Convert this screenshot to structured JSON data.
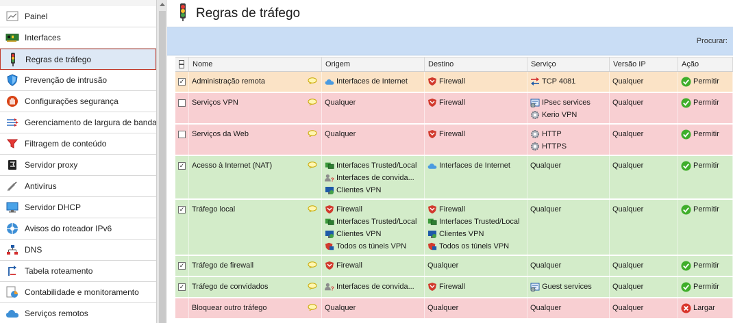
{
  "sidebar": {
    "items": [
      {
        "label": "Painel",
        "icon": "dashboard-icon",
        "active": false
      },
      {
        "label": "Interfaces",
        "icon": "network-card-icon",
        "active": false
      },
      {
        "label": "Regras de tráfego",
        "icon": "traffic-light-icon",
        "active": true
      },
      {
        "label": "Prevenção de intrusão",
        "icon": "shield-icon",
        "active": false
      },
      {
        "label": "Configurações segurança",
        "icon": "stop-hand-icon",
        "active": false
      },
      {
        "label": "Gerenciamento de largura de banda",
        "icon": "bandwidth-arrows-icon",
        "active": false
      },
      {
        "label": "Filtragem de conteúdo",
        "icon": "filter-funnel-icon",
        "active": false
      },
      {
        "label": "Servidor proxy",
        "icon": "proxy-server-icon",
        "active": false
      },
      {
        "label": "Antivírus",
        "icon": "syringe-icon",
        "active": false
      },
      {
        "label": "Servidor DHCP",
        "icon": "monitor-icon",
        "active": false
      },
      {
        "label": "Avisos do roteador IPv6",
        "icon": "network-hub-icon",
        "active": false
      },
      {
        "label": "DNS",
        "icon": "dns-tree-icon",
        "active": false
      },
      {
        "label": "Tabela roteamento",
        "icon": "routing-arrows-icon",
        "active": false
      },
      {
        "label": "Contabilidade e monitoramento",
        "icon": "report-chart-icon",
        "active": false
      },
      {
        "label": "Serviços remotos",
        "icon": "cloud-icon",
        "active": false
      }
    ]
  },
  "header": {
    "title": "Regras de tráfego",
    "icon": "traffic-light-icon"
  },
  "toolbar": {
    "search_label": "Procurar:"
  },
  "table": {
    "columns": [
      "Nome",
      "Origem",
      "Destino",
      "Serviço",
      "Versão IP",
      "Ação"
    ],
    "rows": [
      {
        "checked": true,
        "color": "orange",
        "name": "Administração remota",
        "origin": [
          {
            "icon": "cloud",
            "text": "Interfaces de Internet"
          }
        ],
        "destination": [
          {
            "icon": "firewall",
            "text": "Firewall"
          }
        ],
        "service": [
          {
            "icon": "tcp",
            "text": "TCP 4081"
          }
        ],
        "ip_version": "Qualquer",
        "action": {
          "icon": "allow",
          "text": "Permitir"
        }
      },
      {
        "checked": false,
        "color": "red",
        "name": "Serviços VPN",
        "origin": [
          {
            "icon": "",
            "text": "Qualquer"
          }
        ],
        "destination": [
          {
            "icon": "firewall",
            "text": "Firewall"
          }
        ],
        "service": [
          {
            "icon": "service-book",
            "text": "IPsec services"
          },
          {
            "icon": "gear",
            "text": "Kerio VPN"
          }
        ],
        "ip_version": "Qualquer",
        "action": {
          "icon": "allow",
          "text": "Permitir"
        }
      },
      {
        "checked": false,
        "color": "red",
        "name": "Serviços da Web",
        "origin": [
          {
            "icon": "",
            "text": "Qualquer"
          }
        ],
        "destination": [
          {
            "icon": "firewall",
            "text": "Firewall"
          }
        ],
        "service": [
          {
            "icon": "gear",
            "text": "HTTP"
          },
          {
            "icon": "gear",
            "text": "HTTPS"
          }
        ],
        "ip_version": "Qualquer",
        "action": {
          "icon": "allow",
          "text": "Permitir"
        }
      },
      {
        "checked": true,
        "color": "green",
        "name": "Acesso à Internet (NAT)",
        "origin": [
          {
            "icon": "lan",
            "text": "Interfaces Trusted/Local"
          },
          {
            "icon": "guest",
            "text": "Interfaces de convida..."
          },
          {
            "icon": "vpn",
            "text": "Clientes VPN"
          }
        ],
        "destination": [
          {
            "icon": "cloud",
            "text": "Interfaces de Internet"
          }
        ],
        "service": [
          {
            "icon": "",
            "text": "Qualquer"
          }
        ],
        "ip_version": "Qualquer",
        "action": {
          "icon": "allow",
          "text": "Permitir"
        }
      },
      {
        "checked": true,
        "color": "green",
        "name": "Tráfego local",
        "origin": [
          {
            "icon": "firewall",
            "text": "Firewall"
          },
          {
            "icon": "lan",
            "text": "Interfaces Trusted/Local"
          },
          {
            "icon": "vpn",
            "text": "Clientes VPN"
          },
          {
            "icon": "tunnel",
            "text": "Todos os túneis VPN"
          }
        ],
        "destination": [
          {
            "icon": "firewall",
            "text": "Firewall"
          },
          {
            "icon": "lan",
            "text": "Interfaces Trusted/Local"
          },
          {
            "icon": "vpn",
            "text": "Clientes VPN"
          },
          {
            "icon": "tunnel",
            "text": "Todos os túneis VPN"
          }
        ],
        "service": [
          {
            "icon": "",
            "text": "Qualquer"
          }
        ],
        "ip_version": "Qualquer",
        "action": {
          "icon": "allow",
          "text": "Permitir"
        }
      },
      {
        "checked": true,
        "color": "green",
        "name": "Tráfego de firewall",
        "origin": [
          {
            "icon": "firewall",
            "text": "Firewall"
          }
        ],
        "destination": [
          {
            "icon": "",
            "text": "Qualquer"
          }
        ],
        "service": [
          {
            "icon": "",
            "text": "Qualquer"
          }
        ],
        "ip_version": "Qualquer",
        "action": {
          "icon": "allow",
          "text": "Permitir"
        }
      },
      {
        "checked": true,
        "color": "green",
        "name": "Tráfego de convidados",
        "origin": [
          {
            "icon": "guest",
            "text": "Interfaces de convida..."
          }
        ],
        "destination": [
          {
            "icon": "firewall",
            "text": "Firewall"
          }
        ],
        "service": [
          {
            "icon": "service-book",
            "text": "Guest services"
          }
        ],
        "ip_version": "Qualquer",
        "action": {
          "icon": "allow",
          "text": "Permitir"
        }
      },
      {
        "checked": null,
        "color": "red",
        "name": "Bloquear outro tráfego",
        "origin": [
          {
            "icon": "",
            "text": "Qualquer"
          }
        ],
        "destination": [
          {
            "icon": "",
            "text": "Qualquer"
          }
        ],
        "service": [
          {
            "icon": "",
            "text": "Qualquer"
          }
        ],
        "ip_version": "Qualquer",
        "action": {
          "icon": "drop",
          "text": "Largar"
        }
      }
    ]
  },
  "colors": {
    "allow": "#3fae2a",
    "drop": "#d9362c",
    "firewall": "#c62828",
    "cloud": "#3d8fd6",
    "toolbar": "#c9ddf5"
  }
}
